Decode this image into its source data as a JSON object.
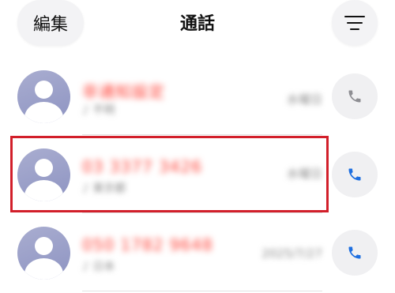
{
  "header": {
    "edit_label": "編集",
    "title": "通話",
    "filter_icon": "filter-lines-icon"
  },
  "calls": [
    {
      "number": "非通知設定",
      "sub": "♪ 不明",
      "date": "水曜日",
      "call_icon": "phone-icon",
      "call_icon_color": "#8e8e93"
    },
    {
      "number": "03 3377 3426",
      "sub": "♪ 東京都",
      "date": "水曜日",
      "call_icon": "phone-icon",
      "call_icon_color": "#1e6fe0"
    },
    {
      "number": "050 1782 9648",
      "sub": "♪ 日本",
      "date": "2025/7/27",
      "call_icon": "phone-icon",
      "call_icon_color": "#1e6fe0"
    }
  ],
  "colors": {
    "missed_number": "#ff3b30",
    "highlight_box": "#d21f2a",
    "avatar": "#9a9fcb"
  }
}
